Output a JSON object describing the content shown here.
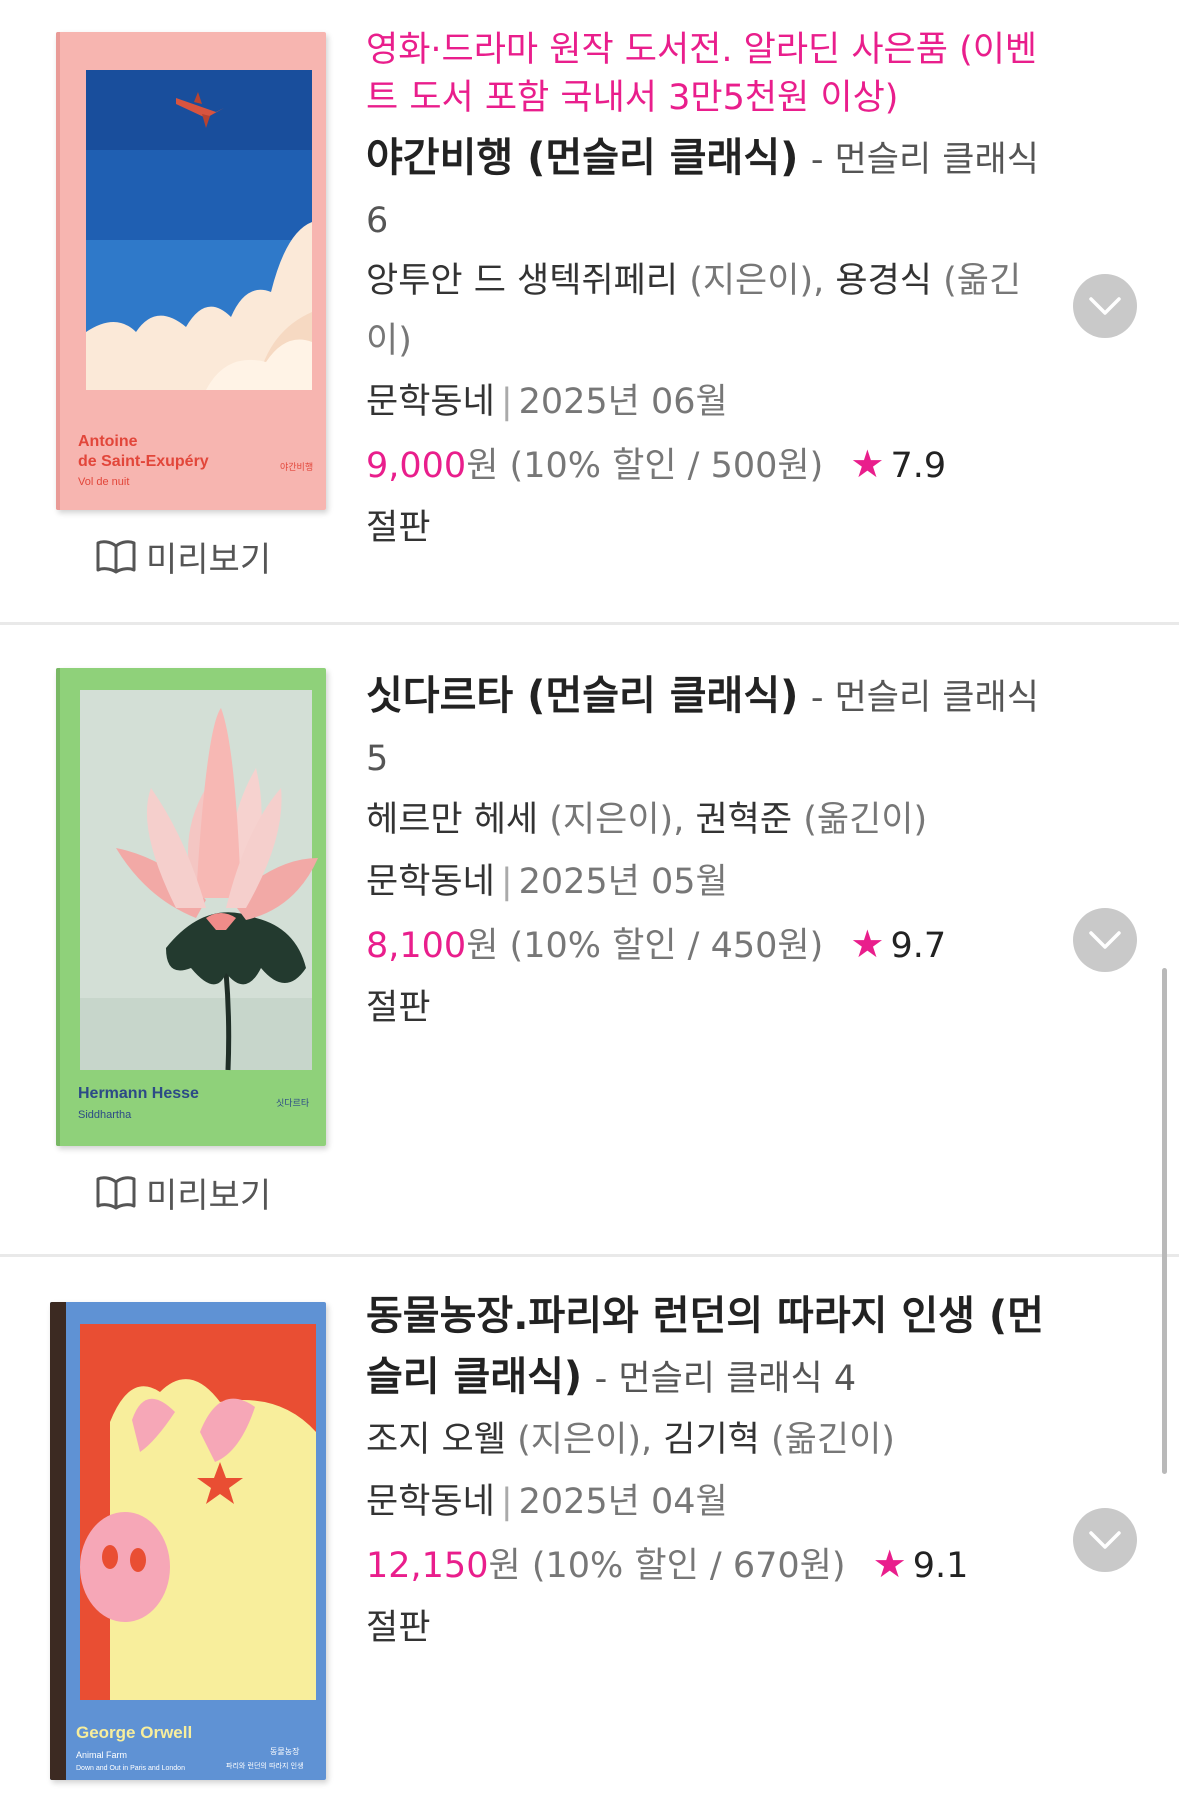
{
  "items": [
    {
      "event": "영화·드라마 원작 도서전. 알라딘 사은품 (이벤트 도서 포함 국내서 3만5천원 이상)",
      "title": "야간비행 (먼슬리 클래식)",
      "series": "- 먼슬리 클래식 6",
      "author": "앙투안 드 생텍쥐페리",
      "author_role": "(지은이),",
      "translator": "용경식",
      "translator_role": "(옮긴이)",
      "publisher": "문학동네",
      "date": "2025년 06월",
      "price": "9,000",
      "price_unit": "원",
      "discount": "(10% 할인 / 500원)",
      "star": "★",
      "rating": "7.9",
      "status": "절판",
      "preview_label": "미리보기",
      "cover": {
        "author_text": "Antoine de Saint-Exupéry",
        "author_line1": "Antoine",
        "author_line2": "de Saint-Exupéry",
        "work": "Vol de nuit",
        "kor": "야간비행"
      }
    },
    {
      "title": "싯다르타 (먼슬리 클래식)",
      "series": "- 먼슬리 클래식 5",
      "author": "헤르만 헤세",
      "author_role": "(지은이),",
      "translator": "권혁준",
      "translator_role": "(옮긴이)",
      "publisher": "문학동네",
      "date": "2025년 05월",
      "price": "8,100",
      "price_unit": "원",
      "discount": "(10% 할인 / 450원)",
      "star": "★",
      "rating": "9.7",
      "status": "절판",
      "preview_label": "미리보기",
      "cover": {
        "author_text": "Hermann Hesse",
        "work": "Siddhartha",
        "kor": "싯다르타"
      }
    },
    {
      "title": "동물농장.파리와 런던의 따라지 인생 (먼슬리 클래식)",
      "series": "- 먼슬리 클래식 4",
      "author": "조지 오웰",
      "author_role": "(지은이),",
      "translator": "김기혁",
      "translator_role": "(옮긴이)",
      "publisher": "문학동네",
      "date": "2025년 04월",
      "price": "12,150",
      "price_unit": "원",
      "discount": "(10% 할인 / 670원)",
      "star": "★",
      "rating": "9.1",
      "status": "절판",
      "cover": {
        "author_text": "George Orwell",
        "work1": "Animal Farm",
        "work2": "Down and Out in Paris and London",
        "kor1": "동물농장",
        "kor2": "파리와 런던의 따라지 인생"
      }
    }
  ],
  "colors": {
    "accent": "#e91e8c",
    "muted": "#777777",
    "expand_button": "#c9c9c9"
  },
  "icons": {
    "preview": "open-book-icon",
    "expand": "chevron-down-icon",
    "rating": "star-icon"
  }
}
